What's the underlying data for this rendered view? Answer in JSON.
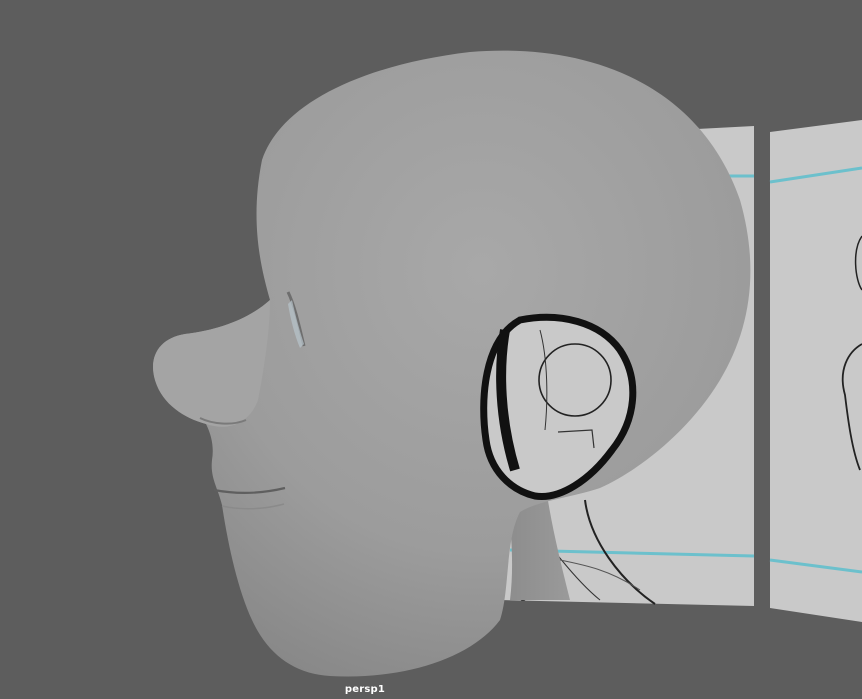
{
  "viewport": {
    "camera_name": "persp1",
    "background_color": "#5d5d5d"
  },
  "scene": {
    "head_color": "#9a9a9a",
    "image_plane_color": "#c8c8c8",
    "guide_line_color": "#6cc0cc",
    "sketch_line_color": "#1a1a1a"
  }
}
